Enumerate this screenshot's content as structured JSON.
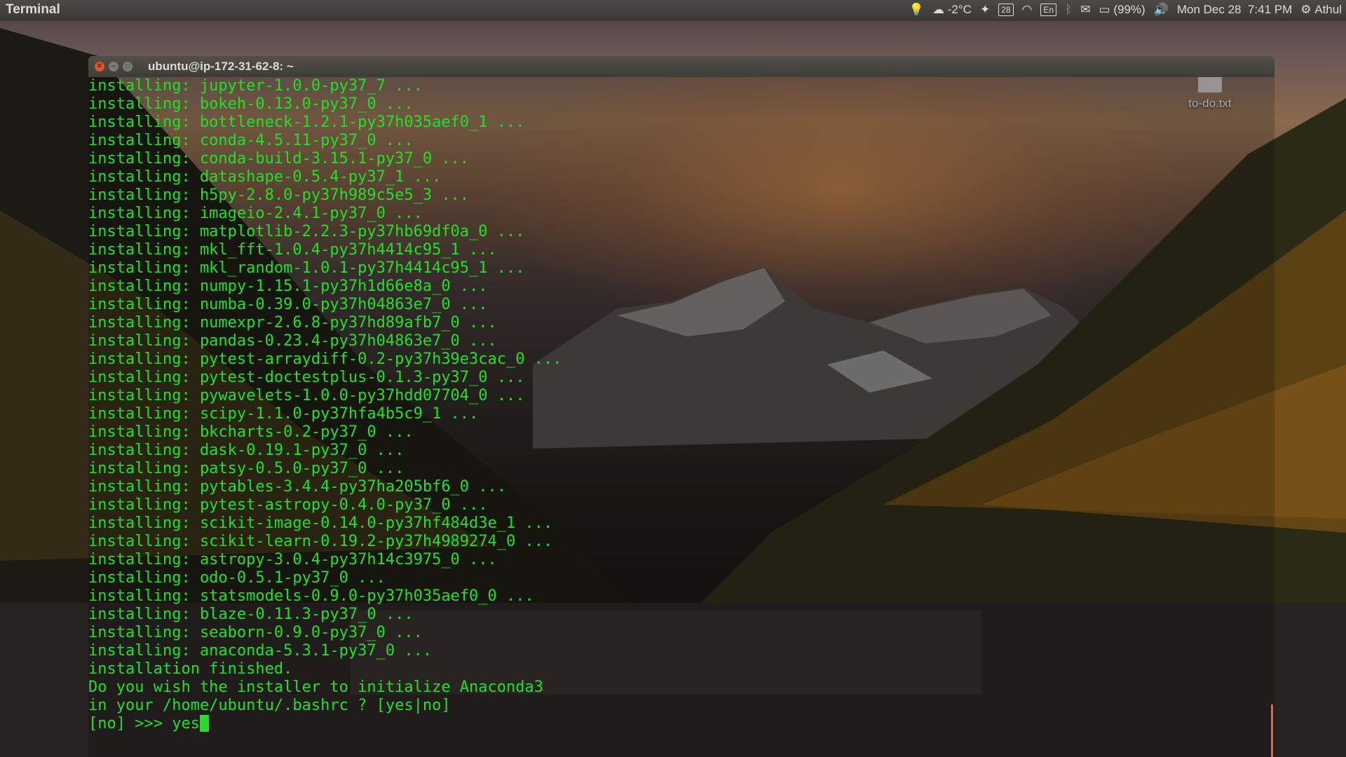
{
  "topbar": {
    "app_name": "Terminal",
    "weather": "-2°C",
    "calendar_day": "28",
    "keyboard_layout": "En",
    "battery": "(99%)",
    "datetime": "Mon Dec 28  7:41 PM",
    "user": "Athul",
    "icons": [
      "lightbulb-icon",
      "weather-icon",
      "dropbox-icon",
      "calendar-icon",
      "wifi-icon",
      "keyboard-layout-icon",
      "bluetooth-icon",
      "mail-icon",
      "battery-icon",
      "volume-icon",
      "gear-icon"
    ]
  },
  "desktop": {
    "file_label": "to-do.txt",
    "file_icon": "text-file-icon"
  },
  "window": {
    "title": "ubuntu@ip-172-31-62-8: ~",
    "buttons": [
      "close",
      "minimize",
      "maximize"
    ]
  },
  "terminal": {
    "text_color": "#22e02a",
    "lines": [
      "installing: jupyter-1.0.0-py37_7 ...",
      "installing: bokeh-0.13.0-py37_0 ...",
      "installing: bottleneck-1.2.1-py37h035aef0_1 ...",
      "installing: conda-4.5.11-py37_0 ...",
      "installing: conda-build-3.15.1-py37_0 ...",
      "installing: datashape-0.5.4-py37_1 ...",
      "installing: h5py-2.8.0-py37h989c5e5_3 ...",
      "installing: imageio-2.4.1-py37_0 ...",
      "installing: matplotlib-2.2.3-py37hb69df0a_0 ...",
      "installing: mkl_fft-1.0.4-py37h4414c95_1 ...",
      "installing: mkl_random-1.0.1-py37h4414c95_1 ...",
      "installing: numpy-1.15.1-py37h1d66e8a_0 ...",
      "installing: numba-0.39.0-py37h04863e7_0 ...",
      "installing: numexpr-2.6.8-py37hd89afb7_0 ...",
      "installing: pandas-0.23.4-py37h04863e7_0 ...",
      "installing: pytest-arraydiff-0.2-py37h39e3cac_0 ...",
      "installing: pytest-doctestplus-0.1.3-py37_0 ...",
      "installing: pywavelets-1.0.0-py37hdd07704_0 ...",
      "installing: scipy-1.1.0-py37hfa4b5c9_1 ...",
      "installing: bkcharts-0.2-py37_0 ...",
      "installing: dask-0.19.1-py37_0 ...",
      "installing: patsy-0.5.0-py37_0 ...",
      "installing: pytables-3.4.4-py37ha205bf6_0 ...",
      "installing: pytest-astropy-0.4.0-py37_0 ...",
      "installing: scikit-image-0.14.0-py37hf484d3e_1 ...",
      "installing: scikit-learn-0.19.2-py37h4989274_0 ...",
      "installing: astropy-3.0.4-py37h14c3975_0 ...",
      "installing: odo-0.5.1-py37_0 ...",
      "installing: statsmodels-0.9.0-py37h035aef0_0 ...",
      "installing: blaze-0.11.3-py37_0 ...",
      "installing: seaborn-0.9.0-py37_0 ...",
      "installing: anaconda-5.3.1-py37_0 ...",
      "installation finished.",
      "Do you wish the installer to initialize Anaconda3",
      "in your /home/ubuntu/.bashrc ? [yes|no]"
    ],
    "prompt": "[no] >>> ",
    "input": "yes"
  }
}
